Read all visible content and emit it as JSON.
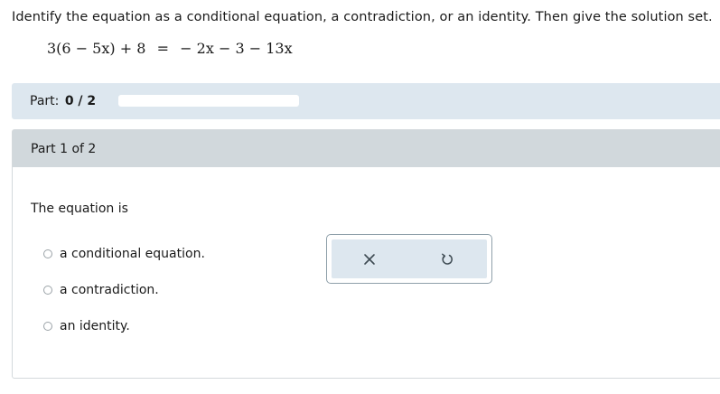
{
  "prompt": "Identify the equation as a conditional equation, a contradiction, or an identity. Then give the solution set.",
  "equation": {
    "left": "3(6 − 5x) + 8",
    "equals": "=",
    "right": "− 2x − 3 − 13x"
  },
  "progress": {
    "label": "Part:",
    "value": "0 / 2",
    "completed": 0,
    "total": 2
  },
  "part": {
    "header": "Part 1 of 2",
    "question": "The equation is",
    "options": [
      "a conditional equation.",
      "a contradiction.",
      "an identity."
    ]
  },
  "tools": {
    "clear_icon": "x-icon",
    "reset_icon": "undo-icon"
  },
  "colors": {
    "accent": "#2a7ab0",
    "band": "#dde7ef",
    "header": "#d1d8dc"
  }
}
